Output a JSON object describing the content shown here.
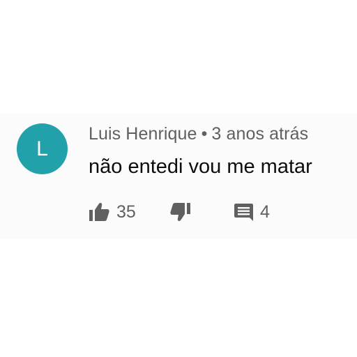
{
  "colors": {
    "avatar_bg": "#23a1aa",
    "meta_text": "#606060",
    "body_text": "#0d0d0d"
  },
  "comment": {
    "avatar_letter": "L",
    "author": "Luis Henrique",
    "separator": "•",
    "timestamp": "3 anos atrás",
    "text": "não entedi vou me matar",
    "like_icon": "thumbs-up-icon",
    "like_count": "35",
    "dislike_icon": "thumbs-down-icon",
    "reply_icon": "comment-icon",
    "reply_count": "4"
  }
}
